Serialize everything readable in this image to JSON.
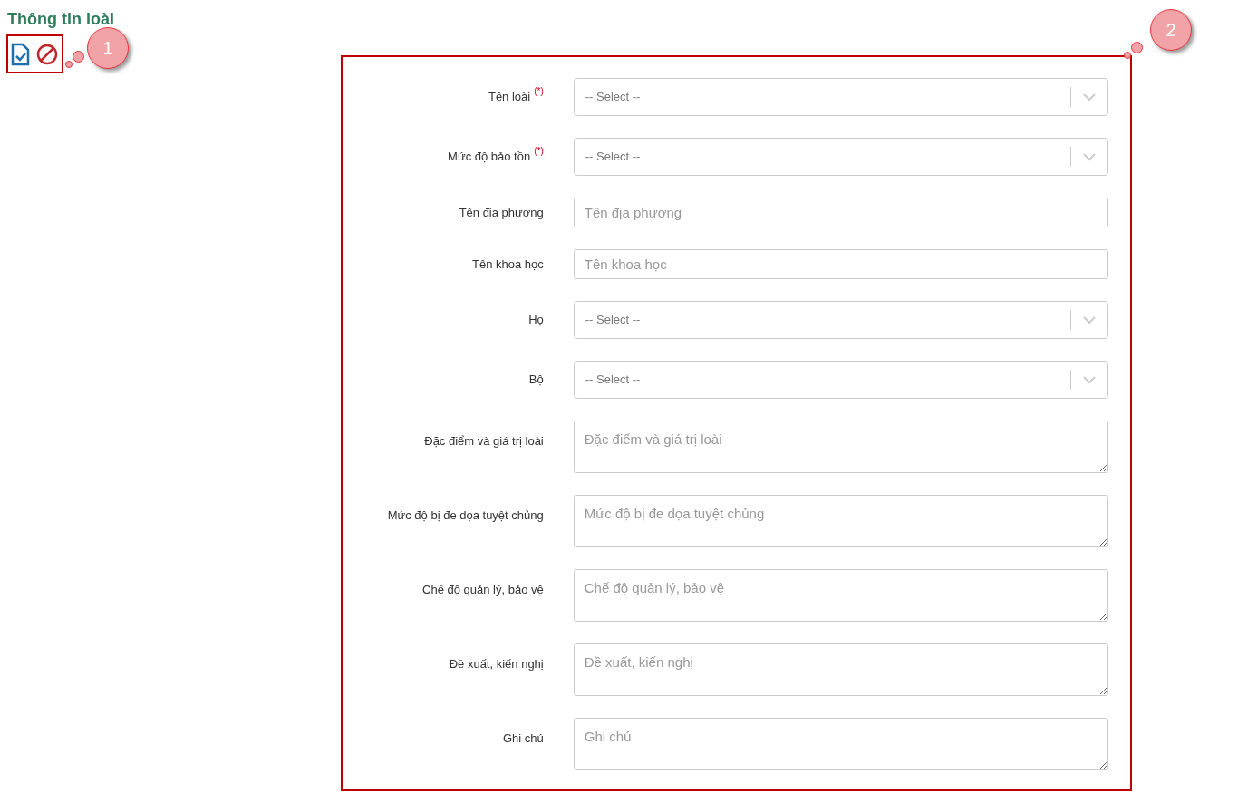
{
  "title": "Thông tin loài",
  "toolbar": {
    "callout": "1"
  },
  "form": {
    "callout": "2",
    "fields": [
      {
        "kind": "select",
        "label": "Tên loài",
        "required_mark": "(*)",
        "placeholder": "-- Select --"
      },
      {
        "kind": "select",
        "label": "Mức độ bảo tồn",
        "required_mark": "(*)",
        "placeholder": "-- Select --"
      },
      {
        "kind": "input",
        "label": "Tên địa phương",
        "placeholder": "Tên địa phương"
      },
      {
        "kind": "input",
        "label": "Tên khoa học",
        "placeholder": "Tên khoa học"
      },
      {
        "kind": "select",
        "label": "Họ",
        "placeholder": "-- Select --"
      },
      {
        "kind": "select",
        "label": "Bộ",
        "placeholder": "-- Select --"
      },
      {
        "kind": "textarea",
        "label": "Đặc điểm và giá trị loài",
        "placeholder": "Đặc điểm và giá trị loài"
      },
      {
        "kind": "textarea",
        "label": "Mức độ bị đe dọa tuyệt chủng",
        "placeholder": "Mức độ bị đe dọa tuyệt chủng"
      },
      {
        "kind": "textarea",
        "label": "Chế độ quản lý, bảo vệ",
        "placeholder": "Chế độ quản lý, bảo vệ"
      },
      {
        "kind": "textarea",
        "label": "Đề xuất, kiến nghị",
        "placeholder": "Đề xuất, kiến nghị"
      },
      {
        "kind": "textarea",
        "label": "Ghi chú",
        "placeholder": "Ghi chú"
      }
    ]
  }
}
